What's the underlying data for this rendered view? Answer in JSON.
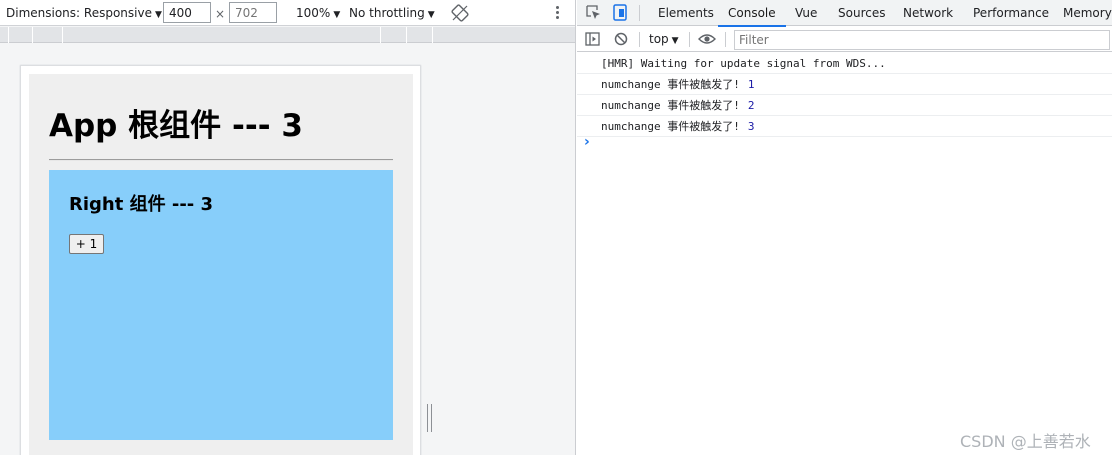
{
  "device_toolbar": {
    "dimensions_label": "Dimensions: Responsive",
    "width_value": "400",
    "height_placeholder": "702",
    "times_symbol": "×",
    "zoom": "100%",
    "throttling": "No throttling",
    "caret": "▼"
  },
  "app": {
    "title": "App 根组件 --- 3",
    "right_component": {
      "title": "Right 组件 --- 3",
      "increment_button": "+ 1"
    }
  },
  "devtools": {
    "tabs": [
      "Elements",
      "Console",
      "Vue",
      "Sources",
      "Network",
      "Performance",
      "Memory"
    ],
    "active_tab": "Console",
    "context": "top",
    "filter_placeholder": "Filter",
    "logs": [
      {
        "text": "[HMR] Waiting for update signal from WDS...",
        "value": ""
      },
      {
        "text": "numchange 事件被触发了!",
        "value": "1"
      },
      {
        "text": "numchange 事件被触发了!",
        "value": "2"
      },
      {
        "text": "numchange 事件被触发了!",
        "value": "3"
      }
    ],
    "prompt": "›"
  },
  "watermark": "CSDN @上善若水",
  "colors": {
    "app_bg": "#efefef",
    "right_bg": "#87cefa",
    "accent": "#1a73e8"
  }
}
